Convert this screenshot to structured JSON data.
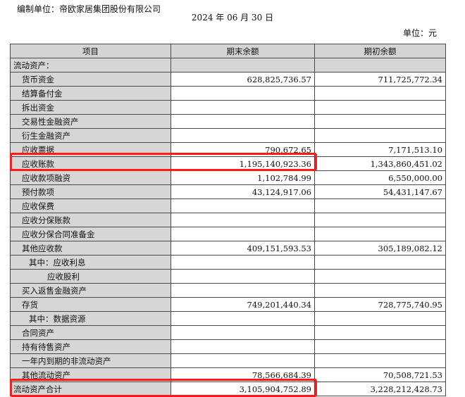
{
  "header": {
    "company": "编制单位：帝欧家居集团股份有限公司",
    "date": "2024 年 06 月 30 日",
    "unit": "单位：元"
  },
  "table": {
    "columns": [
      "项目",
      "期末余额",
      "期初余额"
    ],
    "rows": [
      {
        "item": "流动资产：",
        "end": "",
        "begin": ""
      },
      {
        "item": "货币资金",
        "end": "628,825,736.57",
        "begin": "711,725,772.34"
      },
      {
        "item": "结算备付金",
        "end": "",
        "begin": ""
      },
      {
        "item": "拆出资金",
        "end": "",
        "begin": ""
      },
      {
        "item": "交易性金融资产",
        "end": "",
        "begin": ""
      },
      {
        "item": "衍生金融资产",
        "end": "",
        "begin": ""
      },
      {
        "item": "应收票据",
        "end": "790,672.65",
        "begin": "7,171,513.10"
      },
      {
        "item": "应收账款",
        "end": "1,195,140,923.36",
        "begin": "1,343,860,451.02"
      },
      {
        "item": "应收款项融资",
        "end": "1,102,784.99",
        "begin": "6,550,000.00"
      },
      {
        "item": "预付款项",
        "end": "43,124,917.06",
        "begin": "54,431,147.67"
      },
      {
        "item": "应收保费",
        "end": "",
        "begin": ""
      },
      {
        "item": "应收分保账款",
        "end": "",
        "begin": ""
      },
      {
        "item": "应收分保合同准备金",
        "end": "",
        "begin": ""
      },
      {
        "item": "其他应收款",
        "end": "409,151,593.53",
        "begin": "305,189,082.12"
      },
      {
        "item": "其中：应收利息",
        "end": "",
        "begin": ""
      },
      {
        "item": "应收股利",
        "end": "",
        "begin": ""
      },
      {
        "item": "买入返售金融资产",
        "end": "",
        "begin": ""
      },
      {
        "item": "存货",
        "end": "749,201,440.34",
        "begin": "728,775,740.95"
      },
      {
        "item": "其中：数据资源",
        "end": "",
        "begin": ""
      },
      {
        "item": "合同资产",
        "end": "",
        "begin": ""
      },
      {
        "item": "持有待售资产",
        "end": "",
        "begin": ""
      },
      {
        "item": "一年内到期的非流动资产",
        "end": "",
        "begin": ""
      },
      {
        "item": "其他流动资产",
        "end": "78,566,684.39",
        "begin": "70,508,721.53"
      },
      {
        "item": "流动资产合计",
        "end": "3,105,904,752.89",
        "begin": "3,228,212,428.73"
      }
    ]
  },
  "annotations": {
    "highlight_color": "#ff1a1a"
  }
}
